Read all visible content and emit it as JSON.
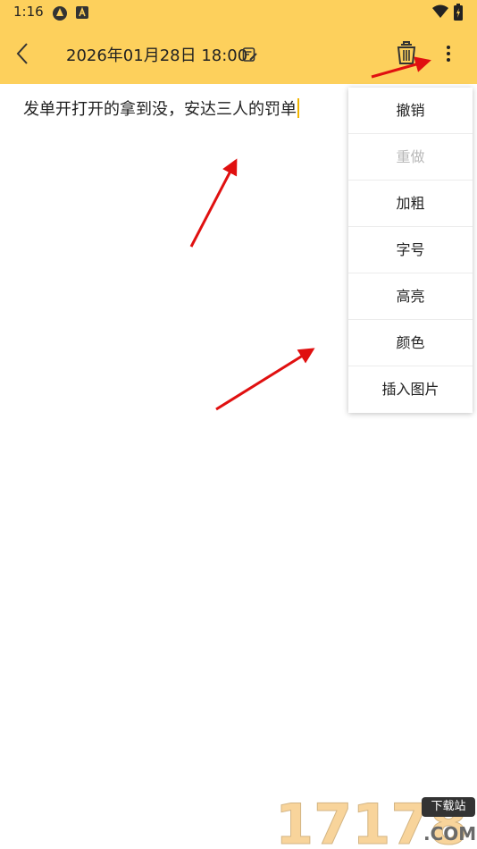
{
  "status_bar": {
    "time": "1:16"
  },
  "toolbar": {
    "title": "2026年01月28日 18:00"
  },
  "editor": {
    "text": "发单开打开的拿到没，安达三人的罚单"
  },
  "menu": {
    "items": [
      {
        "label": "撤销",
        "enabled": true
      },
      {
        "label": "重做",
        "enabled": false
      },
      {
        "label": "加粗",
        "enabled": true
      },
      {
        "label": "字号",
        "enabled": true
      },
      {
        "label": "高亮",
        "enabled": true
      },
      {
        "label": "颜色",
        "enabled": true
      },
      {
        "label": "插入图片",
        "enabled": true
      }
    ]
  },
  "watermark": {
    "digits": "17178",
    "sub": "下载站",
    "domain": ".COM"
  },
  "colors": {
    "header": "#fdd05c",
    "arrow": "#e01010",
    "caret": "#f0b400"
  }
}
